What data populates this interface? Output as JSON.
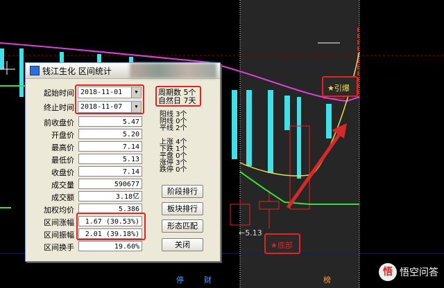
{
  "dialog": {
    "title": "钱江生化 区间统计",
    "start_label": "起始时间",
    "start_date": "2018-11-01",
    "end_label": "终止时间",
    "end_date": "2018-11-07",
    "fields": [
      {
        "label": "前收盘价",
        "value": "5.47"
      },
      {
        "label": "开盘价",
        "value": "5.20"
      },
      {
        "label": "最高价",
        "value": "7.14"
      },
      {
        "label": "最低价",
        "value": "5.13"
      },
      {
        "label": "收盘价",
        "value": "7.14"
      },
      {
        "label": "成交量",
        "value": "590677"
      },
      {
        "label": "成交额",
        "value": "3.18亿"
      },
      {
        "label": "加权均价",
        "value": "5.386"
      },
      {
        "label": "区间涨幅",
        "value": "1.67 (30.53%)"
      },
      {
        "label": "区间振幅",
        "value": "2.01 (39.18%)"
      },
      {
        "label": "区间换手",
        "value": "19.60%"
      }
    ],
    "period_count": "周期数 5个",
    "natural_days": "自然日 7天",
    "line_stats": [
      "阳线 3个",
      "阴线 0个",
      "平线 2个"
    ],
    "move_stats": [
      "上涨 4个",
      "下跌 1个",
      "平盘 0个",
      "涨停 3个",
      "跌停 0个"
    ],
    "buttons": [
      "阶段排行",
      "板块排行",
      "形态匹配",
      "关闭"
    ]
  },
  "chart": {
    "low_price_label": "5.13",
    "annotation_bottom": "★底部",
    "annotation_breakout": "★引爆",
    "footer_markers": [
      "停",
      "财",
      "榜"
    ],
    "colors": {
      "up": "#e52222",
      "down": "#40e0e8",
      "ma_magenta": "#e040e0",
      "ma_yellow": "#e8e04a",
      "ma_green": "#36e236",
      "highlight_bg": "#262626"
    }
  },
  "watermark": {
    "logo": "悟",
    "text": "悟空问答"
  }
}
